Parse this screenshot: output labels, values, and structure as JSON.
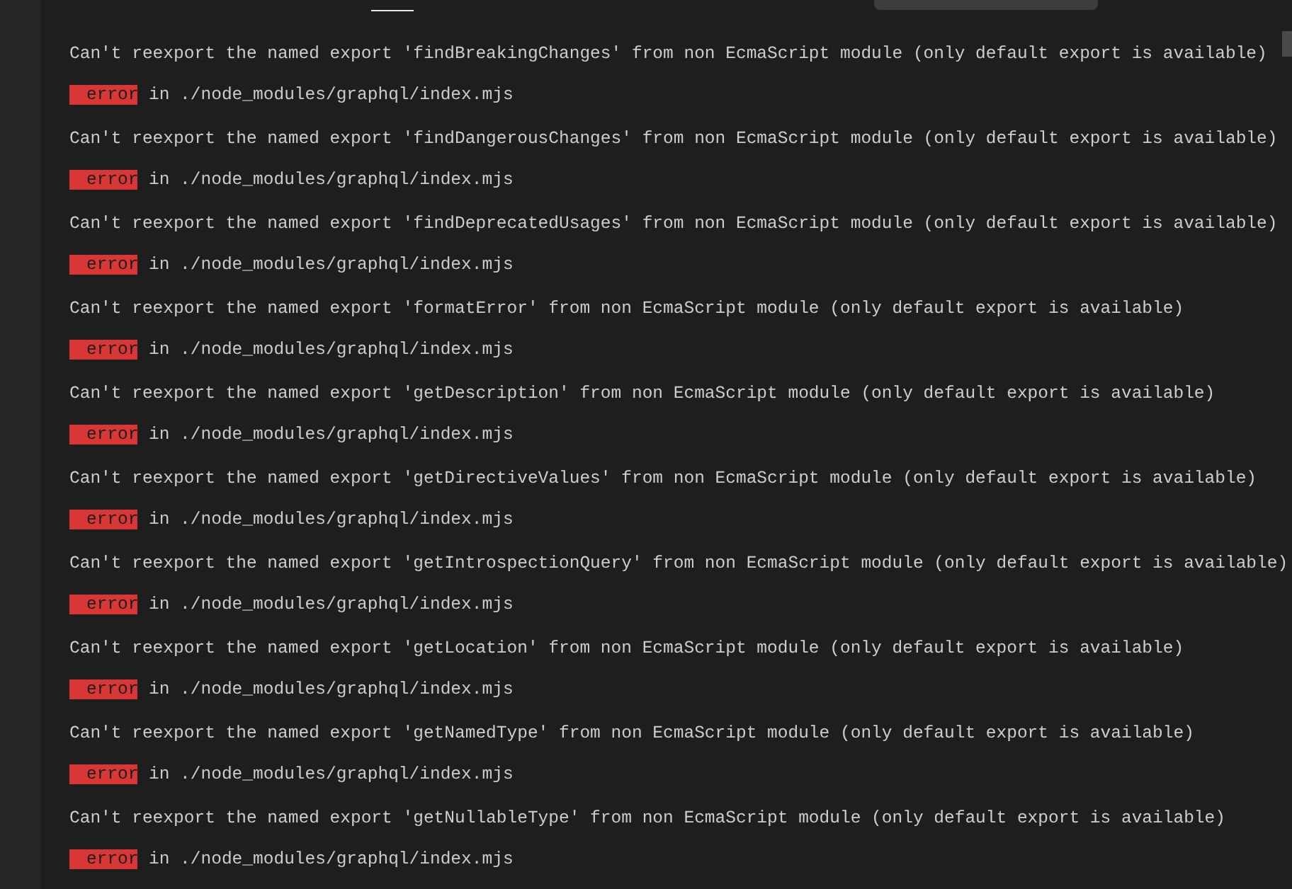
{
  "messages": [
    {
      "text": "Can't reexport the named export 'findBreakingChanges' from non EcmaScript module (only default export is available)",
      "badge": "error",
      "location": "in ./node_modules/graphql/index.mjs"
    },
    {
      "text": "Can't reexport the named export 'findDangerousChanges' from non EcmaScript module (only default export is available)",
      "badge": "error",
      "location": "in ./node_modules/graphql/index.mjs"
    },
    {
      "text": "Can't reexport the named export 'findDeprecatedUsages' from non EcmaScript module (only default export is available)",
      "badge": "error",
      "location": "in ./node_modules/graphql/index.mjs"
    },
    {
      "text": "Can't reexport the named export 'formatError' from non EcmaScript module (only default export is available)",
      "badge": "error",
      "location": "in ./node_modules/graphql/index.mjs"
    },
    {
      "text": "Can't reexport the named export 'getDescription' from non EcmaScript module (only default export is available)",
      "badge": "error",
      "location": "in ./node_modules/graphql/index.mjs"
    },
    {
      "text": "Can't reexport the named export 'getDirectiveValues' from non EcmaScript module (only default export is available)",
      "badge": "error",
      "location": "in ./node_modules/graphql/index.mjs"
    },
    {
      "text": "Can't reexport the named export 'getIntrospectionQuery' from non EcmaScript module (only default export is available)",
      "badge": "error",
      "location": "in ./node_modules/graphql/index.mjs"
    },
    {
      "text": "Can't reexport the named export 'getLocation' from non EcmaScript module (only default export is available)",
      "badge": "error",
      "location": "in ./node_modules/graphql/index.mjs"
    },
    {
      "text": "Can't reexport the named export 'getNamedType' from non EcmaScript module (only default export is available)",
      "badge": "error",
      "location": "in ./node_modules/graphql/index.mjs"
    },
    {
      "text": "Can't reexport the named export 'getNullableType' from non EcmaScript module (only default export is available)",
      "badge": "error",
      "location": "in ./node_modules/graphql/index.mjs"
    }
  ]
}
